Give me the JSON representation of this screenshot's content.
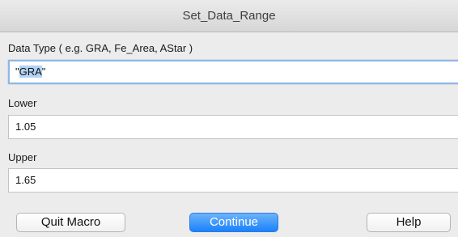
{
  "window": {
    "title": "Set_Data_Range"
  },
  "fields": {
    "data_type": {
      "label": "Data Type ( e.g. GRA, Fe_Area, AStar )",
      "quote_open": "\"",
      "selected_text": "GRA",
      "quote_close": "\""
    },
    "lower": {
      "label": "Lower",
      "value": "1.05"
    },
    "upper": {
      "label": "Upper",
      "value": "1.65"
    }
  },
  "buttons": {
    "quit": "Quit Macro",
    "continue": "Continue",
    "help": "Help"
  },
  "colors": {
    "default_button": "#1a82fb",
    "selection": "#b3d3f5",
    "focus_ring": "#8fb6e8"
  }
}
